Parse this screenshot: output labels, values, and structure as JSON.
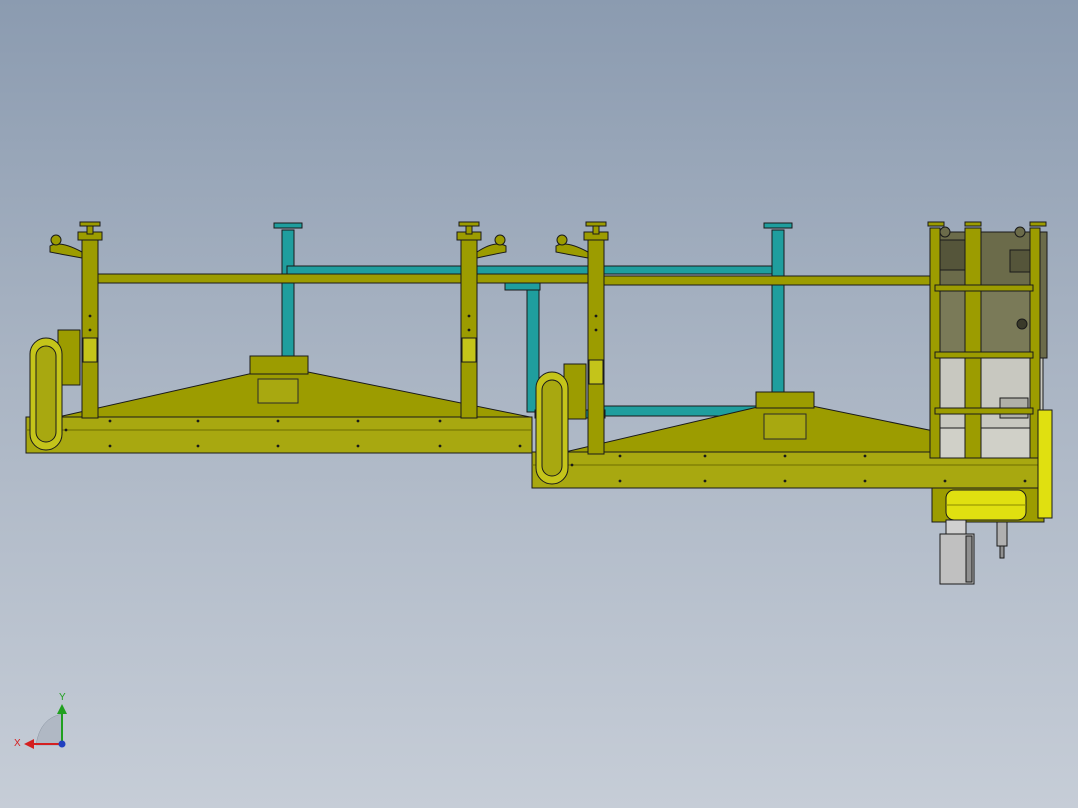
{
  "viewport": {
    "background_top": "#8b9bb0",
    "background_bottom": "#c6cdd7"
  },
  "model": {
    "frame_color": "#9c9c00",
    "frame_highlight": "#c4c41a",
    "frame_dark": "#6e6e00",
    "strut_color": "#1f9e9e",
    "motor_color": "#6b6b4a",
    "housing_color": "#c8c8c0",
    "outline_color": "#1a1a1a",
    "roller_color": "#e0e010"
  },
  "triad": {
    "x_label": "X",
    "y_label": "Y",
    "x_color": "#d42020",
    "y_color": "#20a020",
    "z_color": "#2040c0"
  }
}
